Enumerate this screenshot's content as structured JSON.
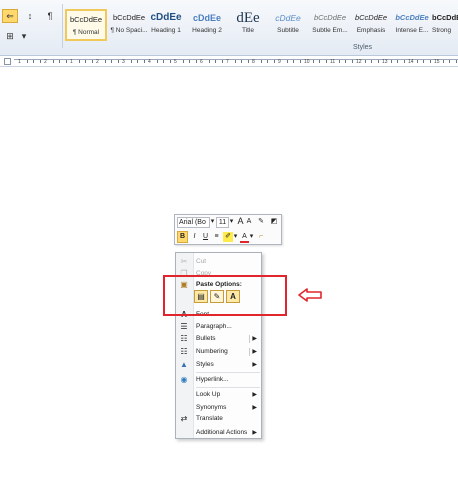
{
  "ribbon": {
    "paragraph_mark": "¶",
    "styles_group_label": "Styles",
    "styles": [
      {
        "sample": "bCcDdEe",
        "label": "¶ Normal"
      },
      {
        "sample": "bCcDdEe",
        "label": "¶ No Spaci..."
      },
      {
        "sample": "cDdEe",
        "label": "Heading 1"
      },
      {
        "sample": "cDdEe",
        "label": "Heading 2"
      },
      {
        "sample": "dEe",
        "label": "Title"
      },
      {
        "sample": "cDdEe",
        "label": "Subtitle"
      },
      {
        "sample": "bCcDdEe",
        "label": "Subtle Em..."
      },
      {
        "sample": "bCcDdEe",
        "label": "Emphasis"
      },
      {
        "sample": "bCcDdEe",
        "label": "Intense E..."
      },
      {
        "sample": "bCcDdEe",
        "label": "Strong"
      }
    ]
  },
  "ruler": {
    "numbers": [
      "1",
      "2",
      "1",
      "2",
      "3",
      "4",
      "5",
      "6",
      "7",
      "8",
      "9",
      "10",
      "11",
      "12",
      "13",
      "14",
      "15"
    ]
  },
  "mini_toolbar": {
    "font_name": "Arial (Bo",
    "font_size": "11",
    "grow": "A",
    "shrink": "A",
    "bold": "B",
    "italic": "I",
    "underline": "U",
    "font_color": "A"
  },
  "context_menu": {
    "cut": "Cut",
    "copy": "Copy",
    "paste_options": "Paste Options:",
    "paste_keep_text": "A",
    "font": "Font...",
    "paragraph": "Paragraph...",
    "bullets": "Bullets",
    "numbering": "Numbering",
    "styles": "Styles",
    "hyperlink": "Hyperlink...",
    "look_up": "Look Up",
    "synonyms": "Synonyms",
    "translate": "Translate",
    "additional_actions": "Additional Actions"
  },
  "colors": {
    "highlight": "#e0262c",
    "accent_fill": "#ffd86e"
  }
}
